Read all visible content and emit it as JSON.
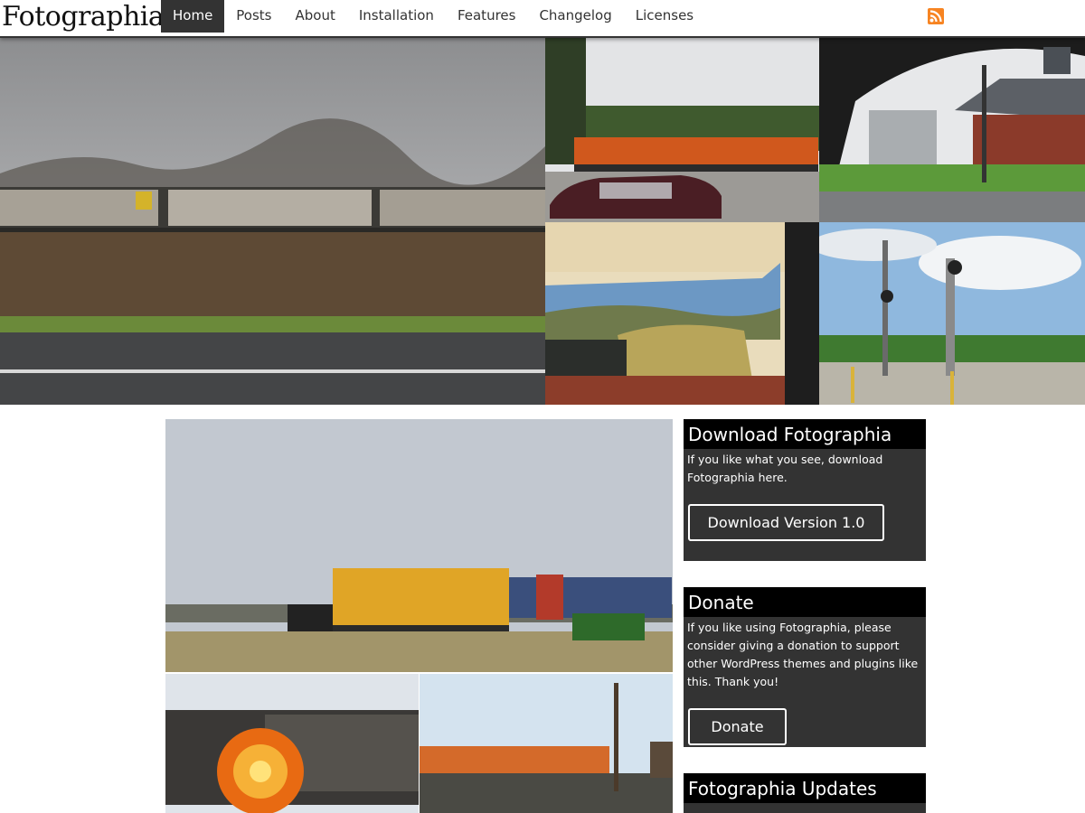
{
  "site": {
    "title": "Fotographia"
  },
  "nav": {
    "items": [
      {
        "label": "Home",
        "active": true
      },
      {
        "label": "Posts"
      },
      {
        "label": "About"
      },
      {
        "label": "Installation"
      },
      {
        "label": "Features"
      },
      {
        "label": "Changelog"
      },
      {
        "label": "Licenses"
      }
    ],
    "rss_icon": "rss-icon",
    "rss_color": "#f78422"
  },
  "sidebar": {
    "download": {
      "title": "Download Fotographia",
      "text": "If you like what you see, download Fotographia here.",
      "button": "Download Version 1.0"
    },
    "donate": {
      "title": "Donate",
      "text": "If you like using Fotographia, please consider giving a donation to support other WordPress themes and plugins like this. Thank you!",
      "button": "Donate"
    },
    "updates": {
      "title": "Fotographia Updates"
    }
  },
  "colors": {
    "header_bar": "#333333",
    "widget_bg": "#333333",
    "widget_title_bg": "#000000"
  }
}
